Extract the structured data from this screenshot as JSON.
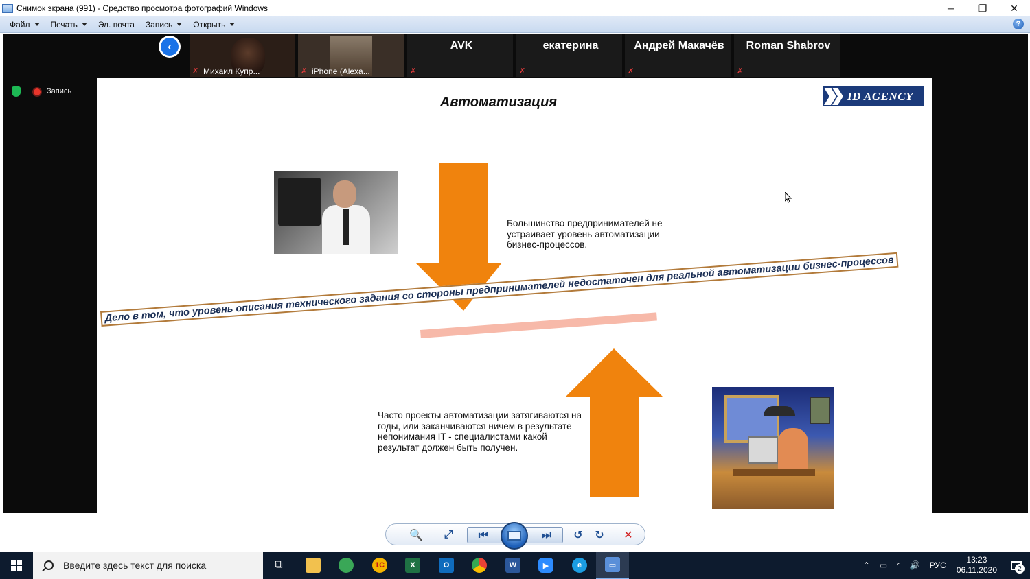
{
  "window": {
    "title": "Снимок экрана (991) - Средство просмотра фотографий Windows",
    "controls": {
      "minimize": "─",
      "maximize": "❐",
      "close": "✕"
    }
  },
  "menu": {
    "items": [
      {
        "label": "Файл",
        "has_dropdown": true
      },
      {
        "label": "Печать",
        "has_dropdown": true
      },
      {
        "label": "Эл. почта",
        "has_dropdown": false
      },
      {
        "label": "Запись",
        "has_dropdown": true
      },
      {
        "label": "Открыть",
        "has_dropdown": true
      }
    ],
    "help": "?"
  },
  "meeting": {
    "participants": [
      {
        "name": "Михаил Купр...",
        "video": true
      },
      {
        "name": "iPhone (Alexa...",
        "video": true
      },
      {
        "name": "AVK",
        "video": false
      },
      {
        "name": "екатерина",
        "video": false
      },
      {
        "name": "Андрей Макачёв",
        "video": false
      },
      {
        "name": "Roman Shabrov",
        "video": false
      }
    ],
    "mute_glyph": "✗",
    "back_glyph": "‹",
    "recording_label": "Запись"
  },
  "slide": {
    "title": "Автоматизация",
    "logo_text": "ID AGENCY",
    "text_top": "Большинство предпринимателей не устраивает уровень автоматизации бизнес-процессов.",
    "banner": "Дело в том, что уровень описания технического задания со стороны предпринимателей недостаточен для реальной автоматизации бизнес-процессов",
    "text_bottom": "Часто проекты автоматизации затягиваются на годы, или заканчиваются ничем в результате непонимания IT - специалистами какой результат должен быть получен.",
    "colors": {
      "arrow": "#f0830d",
      "banner_text": "#1b2f55",
      "logo_bg": "#1b3a7a"
    }
  },
  "viewer_toolbar": {
    "zoom": "🔍",
    "actual_size": "⤢",
    "previous": "⏮",
    "next": "⏭",
    "rotate_ccw": "↺",
    "rotate_cw": "↻",
    "delete": "✕"
  },
  "taskbar": {
    "search_placeholder": "Введите здесь текст для поиска",
    "apps": [
      {
        "name": "task-view",
        "glyph": "⧉",
        "color": "#0d1b2e"
      },
      {
        "name": "file-explorer",
        "glyph": "",
        "color": "#f2c14e"
      },
      {
        "name": "maps",
        "glyph": "",
        "color": "#3aa757"
      },
      {
        "name": "1c",
        "glyph": "1С",
        "color": "#f5b400"
      },
      {
        "name": "excel",
        "glyph": "X",
        "color": "#1f7244"
      },
      {
        "name": "outlook",
        "glyph": "O",
        "color": "#0f6cbd"
      },
      {
        "name": "chrome",
        "glyph": "",
        "color": "#e94235"
      },
      {
        "name": "word",
        "glyph": "W",
        "color": "#2b579a"
      },
      {
        "name": "zoom",
        "glyph": "▶",
        "color": "#2d8cff"
      },
      {
        "name": "edge",
        "glyph": "e",
        "color": "#1b9de2"
      },
      {
        "name": "photos",
        "glyph": "▭",
        "color": "#5a8fd8"
      }
    ],
    "tray": {
      "chevron": "⌃",
      "battery": "▭",
      "network": "◜",
      "volume": "🔊",
      "language": "РУС",
      "time": "13:23",
      "date": "06.11.2020",
      "notifications_count": "2"
    }
  }
}
